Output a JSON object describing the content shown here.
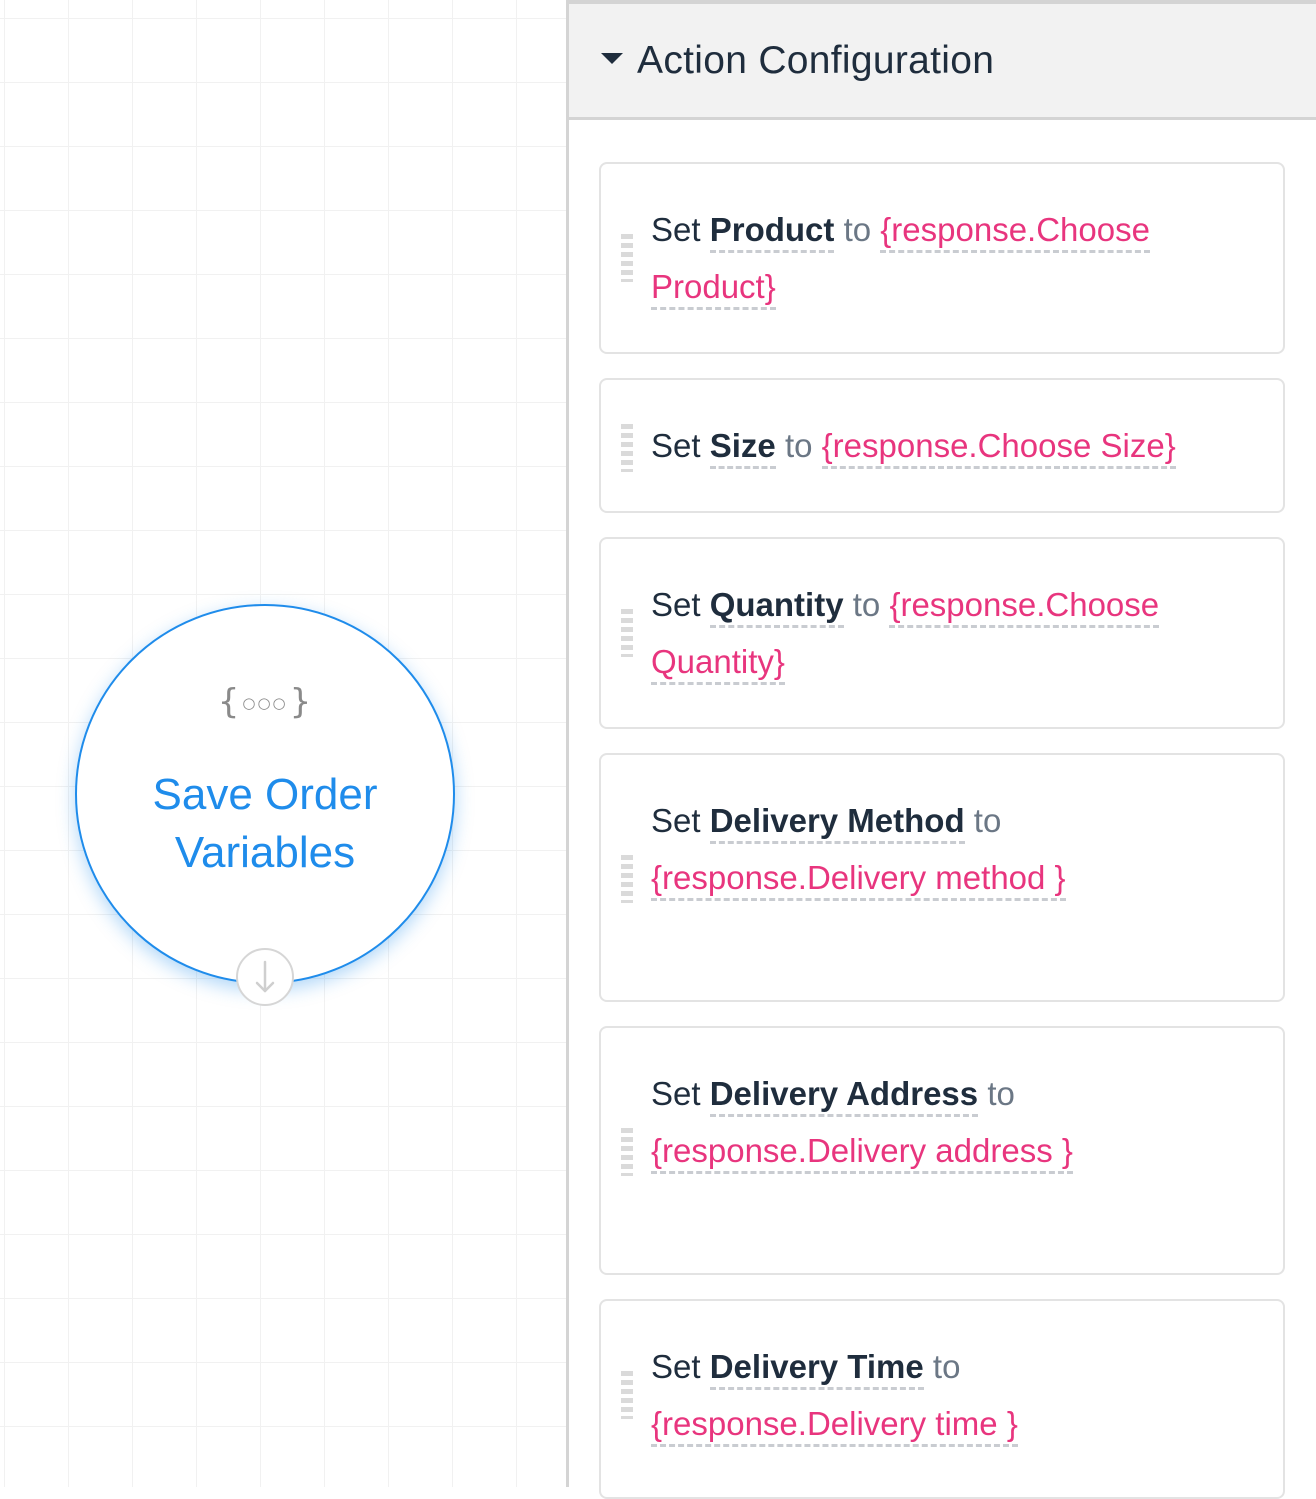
{
  "canvas": {
    "node": {
      "icon": "curly-braces-icon",
      "icon_left": "{",
      "icon_dots": "○○○",
      "icon_right": "}",
      "title": "Save Order Variables",
      "connector_icon": "arrow-down-icon"
    }
  },
  "panel": {
    "title": "Action Configuration",
    "collapse_icon": "caret-down-icon",
    "actions": [
      {
        "set": "Set",
        "variable": "Product",
        "to": "to",
        "value": "{response.Choose Product}"
      },
      {
        "set": "Set",
        "variable": "Size",
        "to": "to",
        "value": "{response.Choose Size}"
      },
      {
        "set": "Set",
        "variable": "Quantity",
        "to": "to",
        "value": "{response.Choose Quantity}"
      },
      {
        "set": "Set",
        "variable": "Delivery Method",
        "to": "to",
        "value": "{response.Delivery method }"
      },
      {
        "set": "Set",
        "variable": "Delivery Address",
        "to": "to",
        "value": "{response.Delivery address }"
      },
      {
        "set": "Set",
        "variable": "Delivery Time",
        "to": "to",
        "value": "{response.Delivery time }"
      }
    ]
  },
  "colors": {
    "accent": "#1f8ceb",
    "value": "#e8357e",
    "text": "#1f2d3d"
  }
}
